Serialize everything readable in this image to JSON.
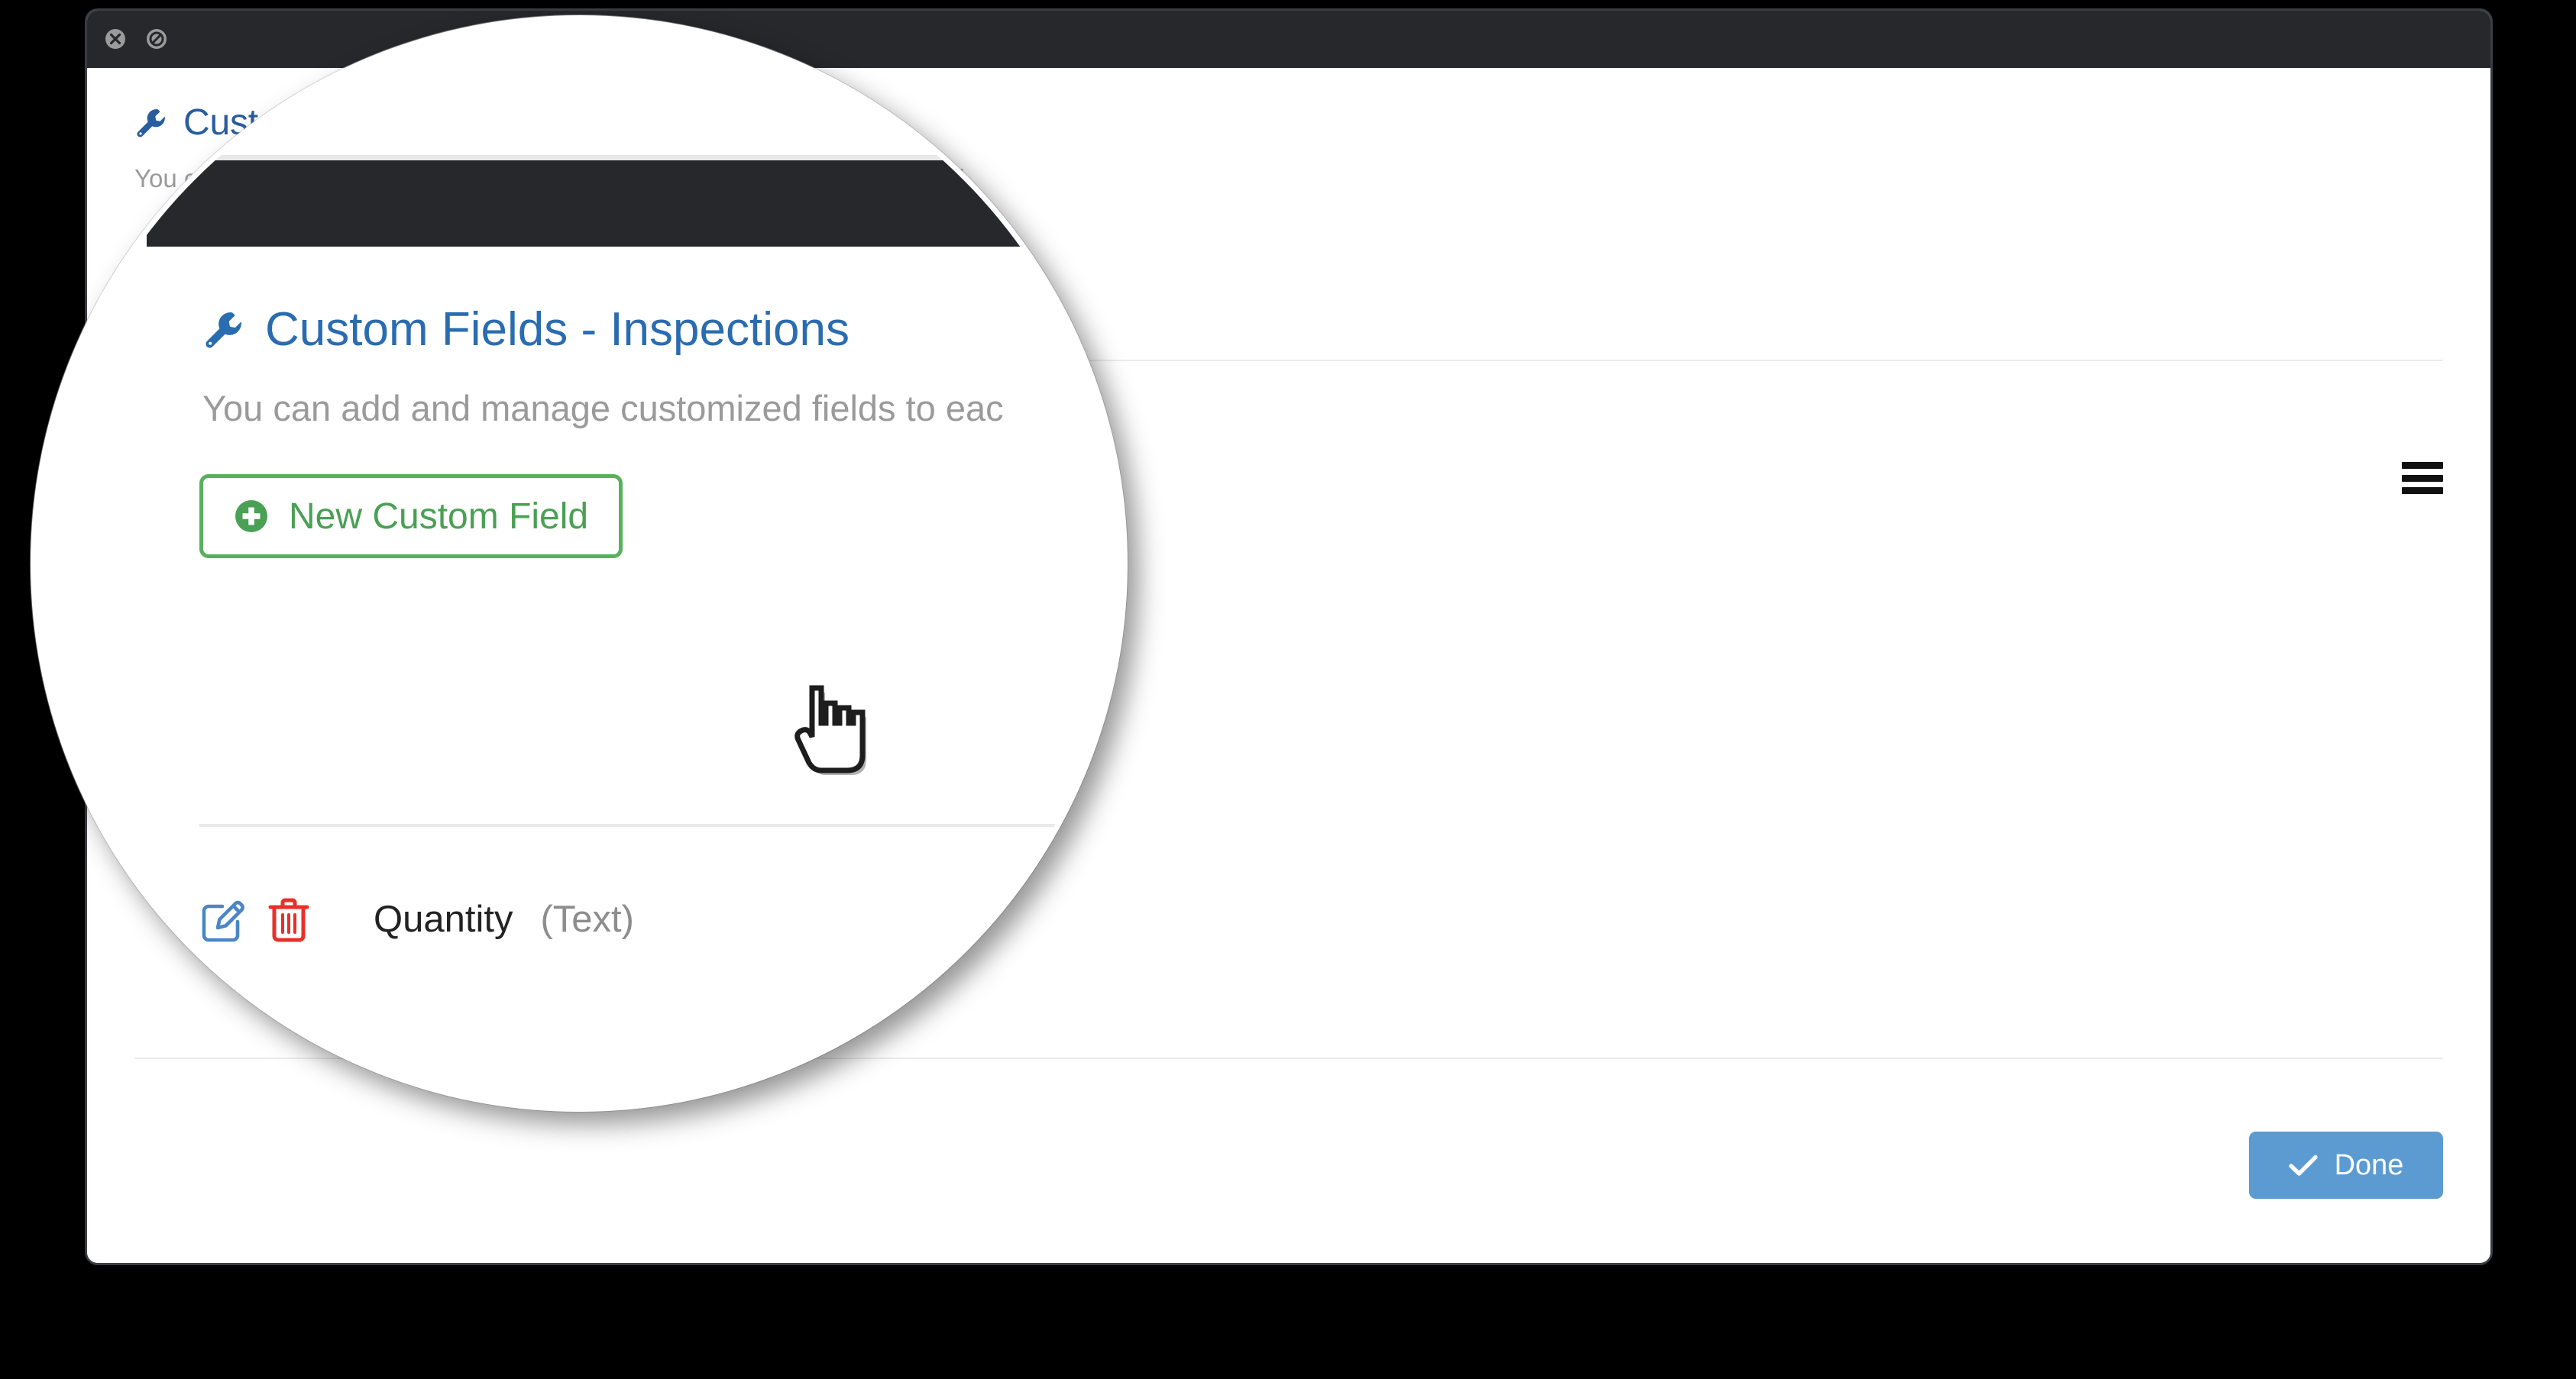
{
  "window": {
    "controls": [
      {
        "name": "close-icon",
        "glyph": "x-in-circle"
      },
      {
        "name": "block-icon",
        "glyph": "slash-in-circle"
      }
    ]
  },
  "dialog": {
    "title": "Custom Fields - Inspections",
    "title_icon": "wrench-icon",
    "description": "You can add and manage customized fields to each inspection as required.",
    "menu_icon": "hamburger-icon",
    "done_label": "Done",
    "done_icon": "check-icon"
  },
  "magnifier": {
    "title": "Custom Fields - Inspections",
    "title_icon": "wrench-icon",
    "description": "You can add and manage customized fields to eac",
    "new_field_label": "New Custom Field",
    "new_field_icon": "plus-circle-icon",
    "cursor": "pointing-hand-cursor",
    "fields": [
      {
        "edit_icon": "edit-pencil-icon",
        "delete_icon": "trash-icon",
        "name": "Quantity",
        "type": "(Text)"
      }
    ]
  },
  "colors": {
    "titlebar": "#26282c",
    "heading_blue": "#2a5d9f",
    "muted_text": "#9a9a9a",
    "green_accent": "#57b05e",
    "red_accent": "#e8302a",
    "blue_accent": "#5b9bd1",
    "edit_blue": "#4a86c8"
  }
}
